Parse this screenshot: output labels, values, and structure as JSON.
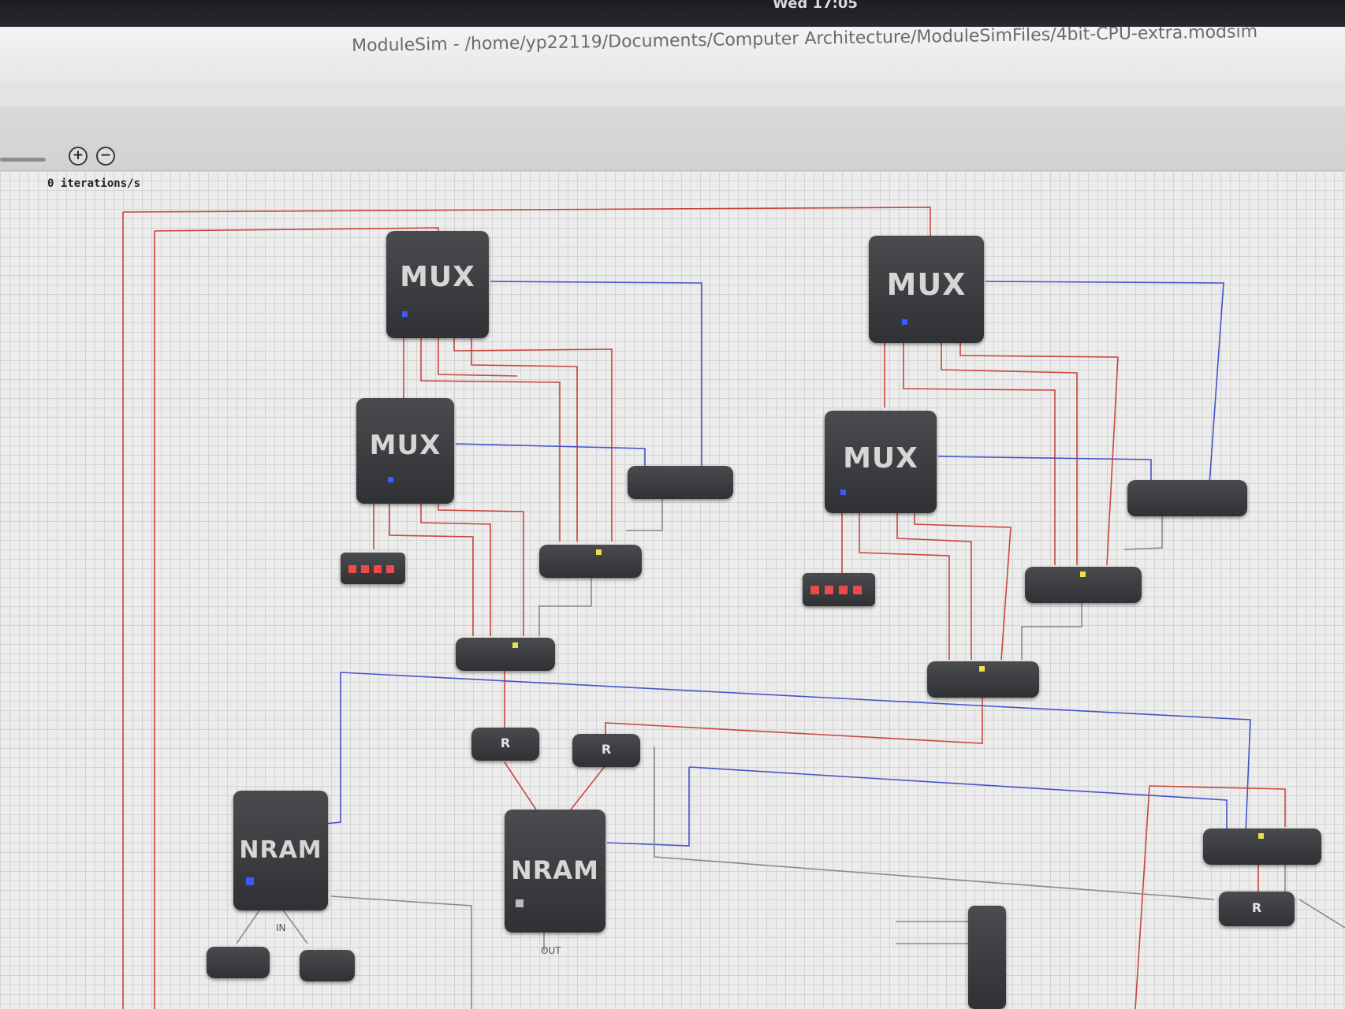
{
  "system": {
    "clock": "Wed 17:05"
  },
  "window": {
    "title": "ModuleSim - /home/yp22119/Documents/Computer Architecture/ModuleSimFiles/4bit-CPU-extra.modsim"
  },
  "toolbar": {
    "zoom_in_icon": "plus-circle-icon",
    "zoom_out_icon": "minus-circle-icon",
    "zoom_in_glyph": "+",
    "zoom_out_glyph": "−"
  },
  "status": {
    "iterations": "0 iterations/s"
  },
  "modules": {
    "mux_label": "MUX",
    "nram_label": "NRAM",
    "register_label": "R",
    "nram_in_label": "IN",
    "nram_out_label": "OUT"
  },
  "colors": {
    "wire_red": "#c9463b",
    "wire_blue": "#4653c7",
    "wire_grey": "#8a8a8a",
    "led_blue": "#3a5cff",
    "led_yellow": "#e9e34a"
  }
}
